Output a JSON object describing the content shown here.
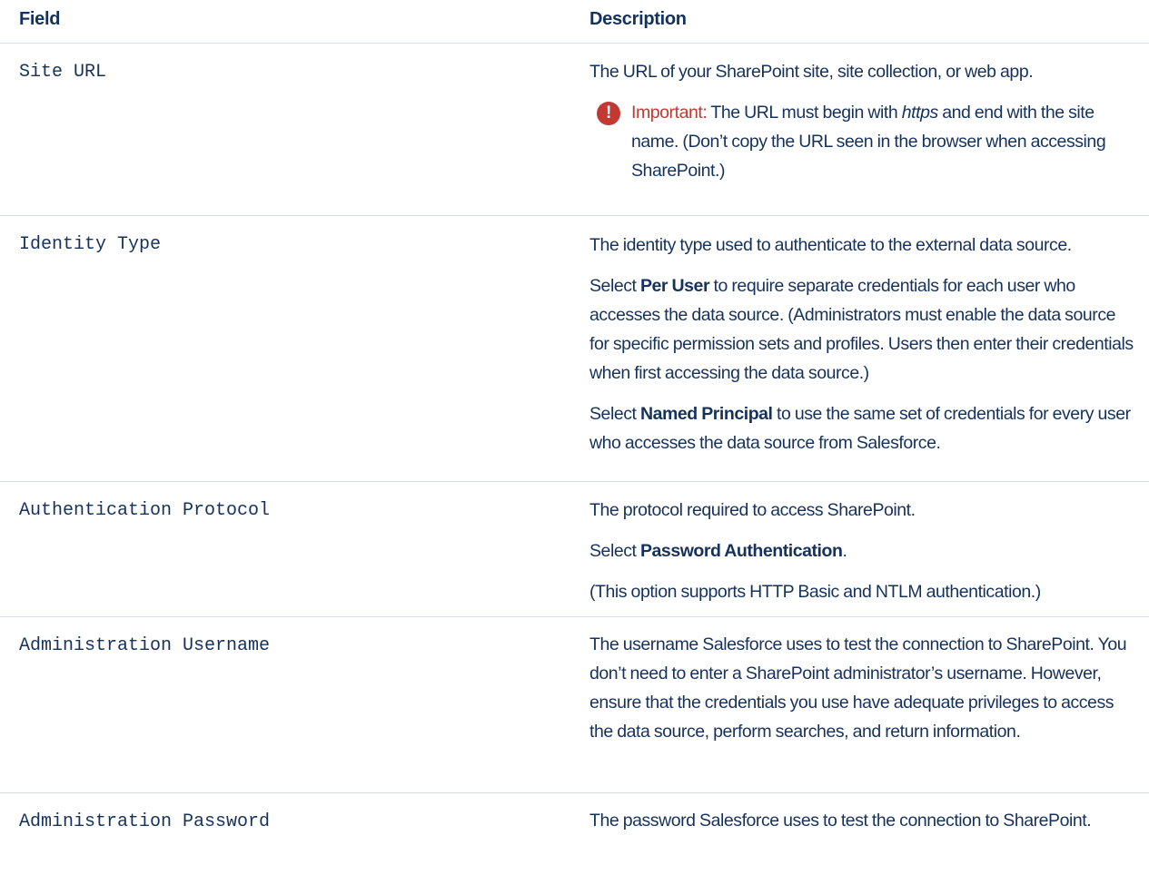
{
  "table": {
    "headers": {
      "field": "Field",
      "description": "Description"
    },
    "rows": [
      {
        "field": "Site URL",
        "desc": "The URL of your SharePoint site, site collection, or web app.",
        "important": {
          "label": "Important:",
          "text_1": " The URL must begin with ",
          "text_italic": "https",
          "text_2": " and end with the site name. (Don’t copy the URL seen in the browser when accessing SharePoint.)"
        }
      },
      {
        "field": "Identity Type",
        "desc_1": "The identity type used to authenticate to the external data source.",
        "desc_2": {
          "pre": "Select ",
          "bold": "Per User",
          "post": " to require separate credentials for each user who accesses the data source. (Administrators must enable the data source for specific permission sets and profiles. Users then enter their credentials when first accessing the data source.)"
        },
        "desc_3": {
          "pre": "Select ",
          "bold": "Named Principal",
          "post": " to use the same set of credentials for every user who accesses the data source from Salesforce."
        }
      },
      {
        "field": "Authentication Protocol",
        "desc_1": "The protocol required to access SharePoint.",
        "desc_2": {
          "pre": "Select ",
          "bold": "Password Authentication",
          "post": "."
        },
        "desc_3": "(This option supports HTTP Basic and NTLM authentication.)"
      },
      {
        "field": "Administration Username",
        "desc": "The username Salesforce uses to test the connection to SharePoint. You don’t need to enter a SharePoint administrator’s username. However, ensure that the credentials you use have adequate privileges to access the data source, perform searches, and return information."
      },
      {
        "field": "Administration Password",
        "desc": "The password Salesforce uses to test the connection to SharePoint."
      }
    ]
  },
  "icons": {
    "important": "exclamation-circle-icon",
    "important_glyph": "!"
  },
  "colors": {
    "text": "#16325c",
    "important": "#c23934",
    "border": "#d8dde6"
  }
}
